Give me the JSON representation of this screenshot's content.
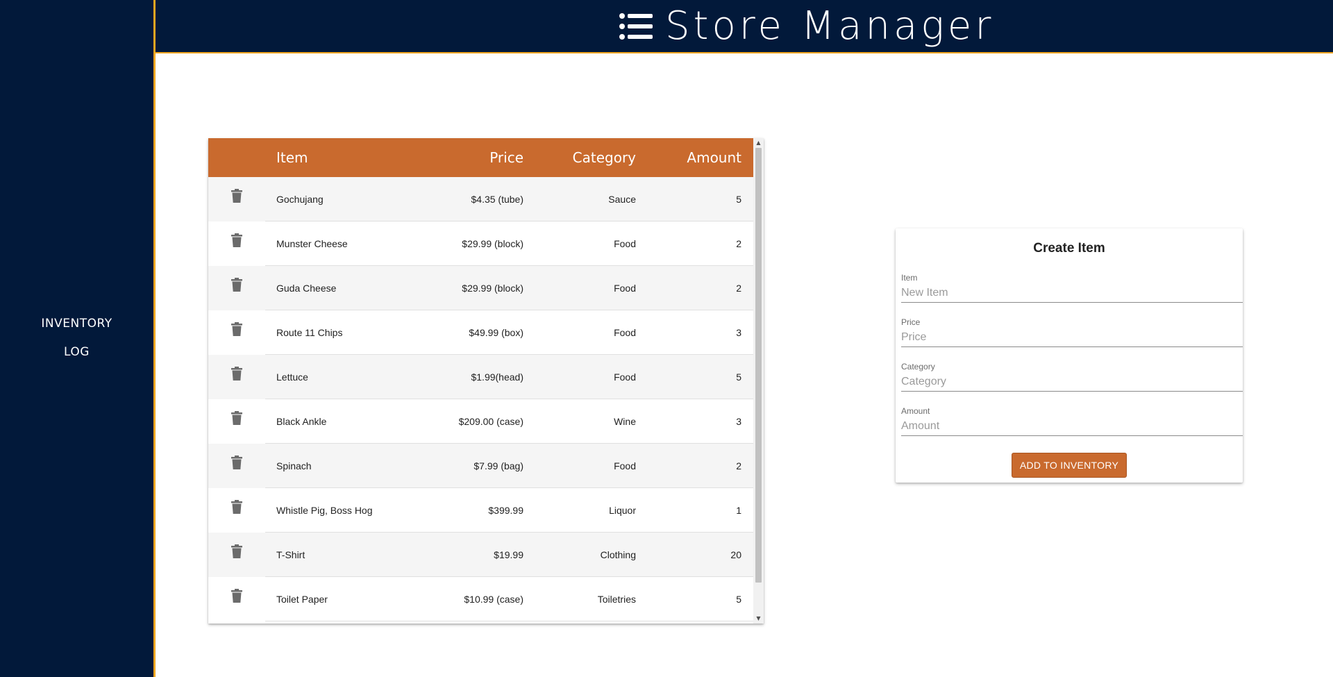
{
  "header": {
    "title": "Store Manager",
    "menu_icon": "menu-list-icon"
  },
  "sidebar": {
    "items": [
      {
        "label": "INVENTORY"
      },
      {
        "label": "LOG"
      }
    ]
  },
  "colors": {
    "navy": "#02193a",
    "accent": "#c96a2e",
    "gold": "#f0a520"
  },
  "table": {
    "headers": {
      "item": "Item",
      "price": "Price",
      "category": "Category",
      "amount": "Amount"
    },
    "row_icon": "trash-icon",
    "rows": [
      {
        "item": "Gochujang",
        "price": "$4.35 (tube)",
        "category": "Sauce",
        "amount": "5"
      },
      {
        "item": "Munster Cheese",
        "price": "$29.99 (block)",
        "category": "Food",
        "amount": "2"
      },
      {
        "item": "Guda Cheese",
        "price": "$29.99 (block)",
        "category": "Food",
        "amount": "2"
      },
      {
        "item": "Route 11 Chips",
        "price": "$49.99 (box)",
        "category": "Food",
        "amount": "3"
      },
      {
        "item": "Lettuce",
        "price": "$1.99(head)",
        "category": "Food",
        "amount": "5"
      },
      {
        "item": "Black Ankle",
        "price": "$209.00 (case)",
        "category": "Wine",
        "amount": "3"
      },
      {
        "item": "Spinach",
        "price": "$7.99 (bag)",
        "category": "Food",
        "amount": "2"
      },
      {
        "item": "Whistle Pig, Boss Hog",
        "price": "$399.99",
        "category": "Liquor",
        "amount": "1"
      },
      {
        "item": "T-Shirt",
        "price": "$19.99",
        "category": "Clothing",
        "amount": "20"
      },
      {
        "item": "Toilet Paper",
        "price": "$10.99 (case)",
        "category": "Toiletries",
        "amount": "5"
      }
    ]
  },
  "form": {
    "title": "Create Item",
    "fields": {
      "item": {
        "label": "Item",
        "placeholder": "New Item",
        "value": ""
      },
      "price": {
        "label": "Price",
        "placeholder": "Price",
        "value": ""
      },
      "category": {
        "label": "Category",
        "placeholder": "Category",
        "value": ""
      },
      "amount": {
        "label": "Amount",
        "placeholder": "Amount",
        "value": ""
      }
    },
    "submit_label": "ADD TO INVENTORY"
  }
}
